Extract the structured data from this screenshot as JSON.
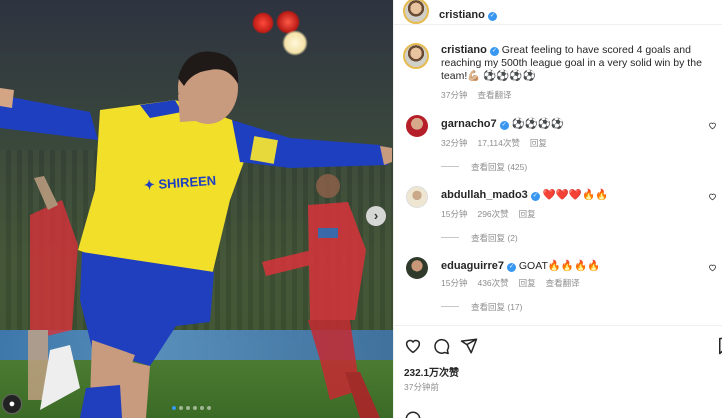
{
  "post": {
    "author": "cristiano",
    "caption": "Great feeling to have scored 4 goals and reaching my 500th league goal in a very solid win by the team!💪🏼 ⚽⚽⚽⚽",
    "caption_time": "37分钟",
    "caption_translate": "查看翻译",
    "likes": "232.1万次赞",
    "posted_ago": "37分钟前",
    "carousel_dots": 6,
    "carousel_active_index": 0
  },
  "comments": [
    {
      "user": "garnacho7",
      "text": "⚽⚽⚽⚽",
      "time": "32分钟",
      "likes": "17,114次赞",
      "reply": "回复",
      "translate": "",
      "view_replies": "查看回复 (425)",
      "avatar_color": "#b51f2a"
    },
    {
      "user": "abdullah_mado3",
      "text": "❤️❤️❤️🔥🔥",
      "time": "15分钟",
      "likes": "296次赞",
      "reply": "回复",
      "translate": "",
      "view_replies": "查看回复 (2)",
      "avatar_color": "#efe6d2"
    },
    {
      "user": "eduaguirre7",
      "text": "GOAT🔥🔥🔥🔥",
      "time": "15分钟",
      "likes": "436次赞",
      "reply": "回复",
      "translate": "查看翻译",
      "view_replies": "查看回复 (17)",
      "avatar_color": "#2f3a2a"
    }
  ],
  "colors": {
    "accent": "#3897f0",
    "meta": "#8e8e8e",
    "text": "#262626"
  }
}
